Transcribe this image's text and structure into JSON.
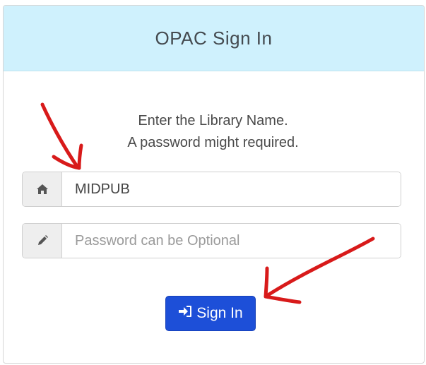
{
  "header": {
    "title": "OPAC Sign In"
  },
  "instructions": {
    "line1": "Enter the Library Name.",
    "line2": "A password might required."
  },
  "form": {
    "library": {
      "value": "MIDPUB",
      "icon": "home-icon"
    },
    "password": {
      "placeholder": "Password can be Optional",
      "value": "",
      "icon": "pencil-icon"
    },
    "submit_label": "Sign In",
    "submit_icon": "sign-in-icon"
  },
  "colors": {
    "header_bg": "#cff1fd",
    "button_bg": "#1d4fd8",
    "annotation_arrows": "#d81a1a"
  }
}
